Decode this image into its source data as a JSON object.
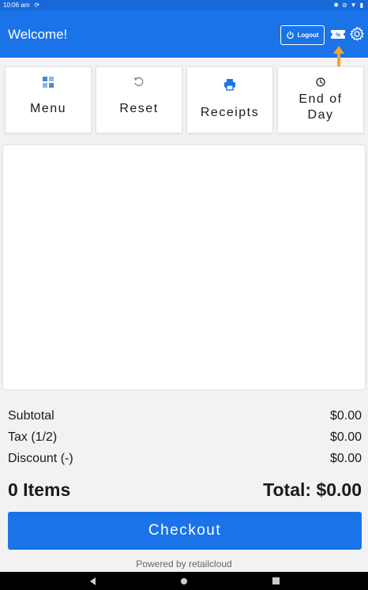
{
  "status_bar": {
    "time": "10:06",
    "ampm": "am"
  },
  "header": {
    "welcome": "Welcome!",
    "logout_label": "Logout"
  },
  "tiles": [
    {
      "label": "Menu"
    },
    {
      "label": "Reset"
    },
    {
      "label": "Receipts"
    },
    {
      "label": "End of Day"
    }
  ],
  "summary": {
    "subtotal_label": "Subtotal",
    "subtotal_value": "$0.00",
    "tax_label": "Tax (1/2)",
    "tax_value": "$0.00",
    "discount_label": "Discount (-)",
    "discount_value": "$0.00",
    "items_label": "0 Items",
    "total_label": "Total: $0.00"
  },
  "checkout_label": "Checkout",
  "footer": {
    "powered_by": "Powered by retailcloud"
  },
  "colors": {
    "primary": "#1a73e8",
    "annotation_arrow": "#f5a623"
  },
  "icons": {
    "menu": "grid-icon",
    "reset": "refresh-icon",
    "receipts": "printer-icon",
    "end_of_day": "clock-icon",
    "settings": "gear-icon",
    "ticket": "ticket-icon",
    "logout": "power-icon"
  }
}
